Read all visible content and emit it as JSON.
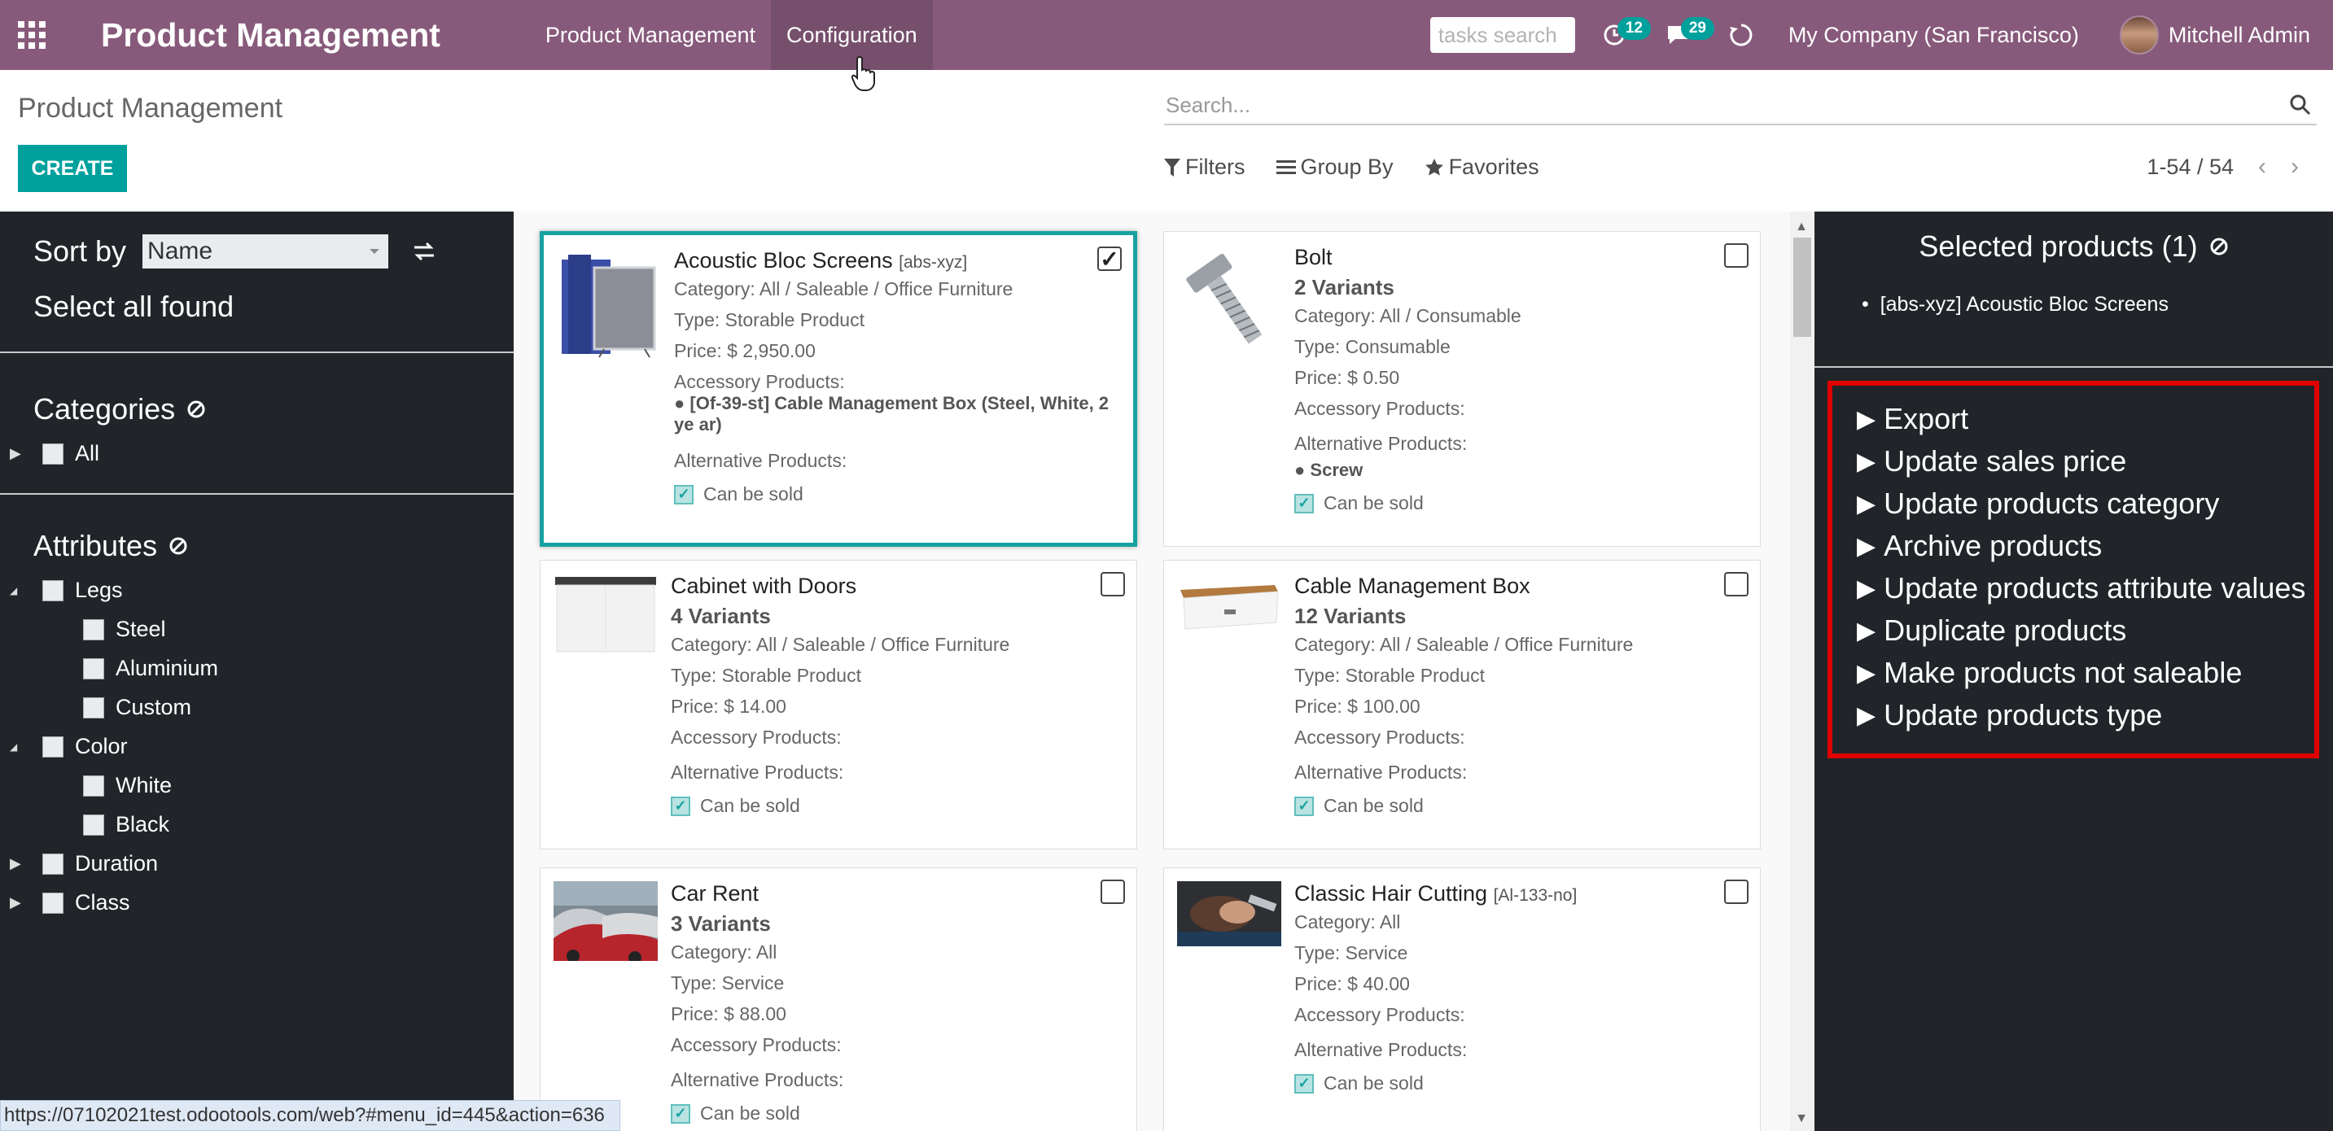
{
  "navbar": {
    "brand": "Product Management",
    "menu": [
      "Product Management",
      "Configuration"
    ],
    "tasks_placeholder": "tasks search",
    "activity_count": "12",
    "messages_count": "29",
    "company": "My Company (San Francisco)",
    "user": "Mitchell Admin"
  },
  "control": {
    "title": "Product Management",
    "create": "CREATE",
    "search_placeholder": "Search...",
    "filters": "Filters",
    "group_by": "Group By",
    "favorites": "Favorites",
    "pager": "1-54 / 54"
  },
  "sidebar": {
    "sort_label": "Sort by",
    "sort_value": "Name",
    "select_all": "Select all found",
    "categories_title": "Categories",
    "categories": [
      "All"
    ],
    "attributes_title": "Attributes",
    "attributes": [
      {
        "label": "Legs",
        "level": 0,
        "expandable": "open"
      },
      {
        "label": "Steel",
        "level": 1
      },
      {
        "label": "Aluminium",
        "level": 1
      },
      {
        "label": "Custom",
        "level": 1
      },
      {
        "label": "Color",
        "level": 0,
        "expandable": "open"
      },
      {
        "label": "White",
        "level": 1
      },
      {
        "label": "Black",
        "level": 1
      },
      {
        "label": "Duration",
        "level": 0,
        "expandable": "closed"
      },
      {
        "label": "Class",
        "level": 0,
        "expandable": "closed"
      }
    ]
  },
  "products": [
    {
      "name": "Acoustic Bloc Screens",
      "ref": "[abs-xyz]",
      "variants": "",
      "category": "Category: All / Saleable / Office Furniture",
      "type": "Type: Storable Product",
      "price": "Price: $ 2,950.00",
      "accessory_label": "Accessory Products:",
      "accessory_item": "[Of-39-st] Cable Management Box (Steel, White, 2 ye ar)",
      "alternative_label": "Alternative Products:",
      "alternative_item": "",
      "can_sold": "Can be sold",
      "selected": true,
      "image": "screens"
    },
    {
      "name": "Bolt",
      "ref": "",
      "variants": "2 Variants",
      "category": "Category: All / Consumable",
      "type": "Type: Consumable",
      "price": "Price: $ 0.50",
      "accessory_label": "Accessory Products:",
      "accessory_item": "",
      "alternative_label": "Alternative Products:",
      "alternative_item": "Screw",
      "can_sold": "Can be sold",
      "selected": false,
      "image": "bolt"
    },
    {
      "name": "Cabinet with Doors",
      "ref": "",
      "variants": "4 Variants",
      "category": "Category: All / Saleable / Office Furniture",
      "type": "Type: Storable Product",
      "price": "Price: $ 14.00",
      "accessory_label": "Accessory Products:",
      "accessory_item": "",
      "alternative_label": "Alternative Products:",
      "alternative_item": "",
      "can_sold": "Can be sold",
      "selected": false,
      "image": "cabinet"
    },
    {
      "name": "Cable Management Box",
      "ref": "",
      "variants": "12 Variants",
      "category": "Category: All / Saleable / Office Furniture",
      "type": "Type: Storable Product",
      "price": "Price: $ 100.00",
      "accessory_label": "Accessory Products:",
      "accessory_item": "",
      "alternative_label": "Alternative Products:",
      "alternative_item": "",
      "can_sold": "Can be sold",
      "selected": false,
      "image": "cablebox"
    },
    {
      "name": "Car Rent",
      "ref": "",
      "variants": "3 Variants",
      "category": "Category: All",
      "type": "Type: Service",
      "price": "Price: $ 88.00",
      "accessory_label": "Accessory Products:",
      "accessory_item": "",
      "alternative_label": "Alternative Products:",
      "alternative_item": "",
      "can_sold": "Can be sold",
      "selected": false,
      "image": "cars"
    },
    {
      "name": "Classic Hair Cutting",
      "ref": "[Al-133-no]",
      "variants": "",
      "category": "Category: All",
      "type": "Type: Service",
      "price": "Price: $ 40.00",
      "accessory_label": "Accessory Products:",
      "accessory_item": "",
      "alternative_label": "Alternative Products:",
      "alternative_item": "",
      "can_sold": "Can be sold",
      "selected": false,
      "image": "hair"
    }
  ],
  "right_panel": {
    "selected_title": "Selected products (1)",
    "selected_items": [
      "[abs-xyz] Acoustic Bloc Screens"
    ],
    "actions": [
      "Export",
      "Update sales price",
      "Update products category",
      "Archive products",
      "Update products attribute values",
      "Duplicate products",
      "Make products not saleable",
      "Update products type"
    ]
  },
  "status_url": "https://07102021test.odootools.com/web?#menu_id=445&action=636"
}
